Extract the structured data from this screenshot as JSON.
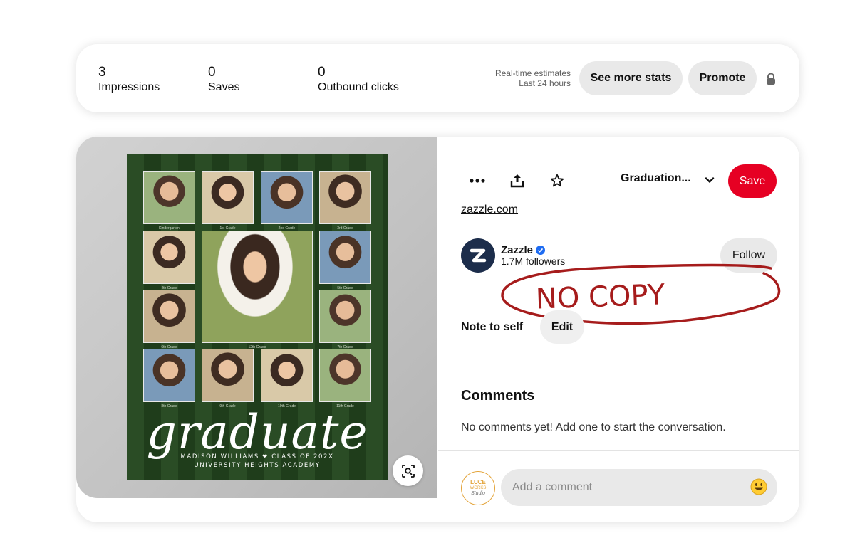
{
  "stats": {
    "impressions": {
      "value": "3",
      "label": "Impressions"
    },
    "saves": {
      "value": "0",
      "label": "Saves"
    },
    "outbound": {
      "value": "0",
      "label": "Outbound clicks"
    },
    "estimates_line1": "Real-time estimates",
    "estimates_line2": "Last 24 hours",
    "see_more_label": "See more stats",
    "promote_label": "Promote"
  },
  "pin": {
    "image": {
      "script_word": "graduate",
      "line1": "MADISON WILLIAMS ❤ CLASS OF 202X",
      "line2": "UNIVERSITY HEIGHTS ACADEMY"
    },
    "board": "Graduation...",
    "save_label": "Save",
    "link": "zazzle.com",
    "author": {
      "name": "Zazzle",
      "followers": "1.7M followers",
      "follow_label": "Follow"
    },
    "watermark": "NO COPY",
    "note_label": "Note to self",
    "edit_label": "Edit",
    "comments_title": "Comments",
    "no_comments": "No comments yet! Add one to start the conversation.",
    "comment_placeholder": "Add a comment",
    "user_avatar": {
      "line1": "LUCE",
      "line2": "WORKS",
      "line3": "Studio"
    }
  },
  "icons": [
    "more-icon",
    "share-icon",
    "star-icon",
    "chevron-down-icon",
    "lock-icon",
    "visual-search-icon",
    "verified-icon",
    "emoji-icon"
  ],
  "colors": {
    "accent": "#e60023",
    "pill_bg": "#e9e9e9",
    "poster_green": "#2a4c25",
    "watermark": "#a61c1c"
  }
}
